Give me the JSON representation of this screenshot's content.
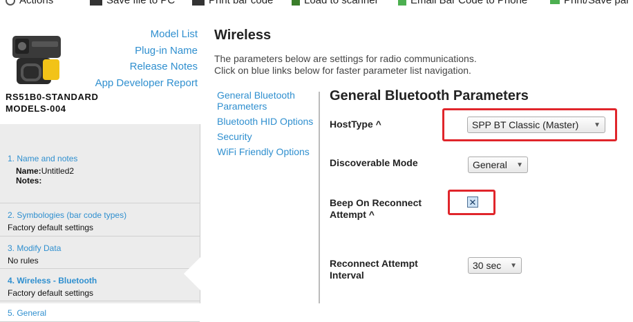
{
  "toolbar": {
    "actions": "Actions",
    "save_file": "Save file to PC",
    "print_barcode": "Print bar code",
    "load_scanner": "Load to scanner",
    "email_barcode": "Email Bar Code to Phone",
    "print_save": "Print/Save par"
  },
  "sidebar": {
    "model_links": [
      "Model List",
      "Plug-in Name",
      "Release Notes",
      "App Developer Report"
    ],
    "device_name_line1": "RS51B0-STANDARD",
    "device_name_line2": "MODELS-004",
    "steps": [
      {
        "title": "1.  Name and notes",
        "name_label": "Name:",
        "name_value": "Untitled2",
        "notes_label": "Notes:"
      },
      {
        "title": "2.  Symbologies (bar code types)",
        "sub": "Factory default settings"
      },
      {
        "title": "3.  Modify Data",
        "sub": "No rules"
      },
      {
        "title": "4.  Wireless - Bluetooth",
        "sub": "Factory default settings"
      },
      {
        "title": "5.  General"
      }
    ]
  },
  "main": {
    "title": "Wireless",
    "intro_line1": "The parameters below are settings for radio communications.",
    "intro_line2": "Click on blue links below for faster parameter list navigation.",
    "subnav": [
      "General Bluetooth Parameters",
      "Bluetooth HID Options",
      "Security",
      "WiFi Friendly Options"
    ],
    "section_title": "General Bluetooth Parameters",
    "params": {
      "hosttype_label": "HostType ^",
      "hosttype_value": "SPP BT Classic (Master)",
      "discoverable_label": "Discoverable Mode",
      "discoverable_value": "General",
      "beep_label_line1": "Beep On Reconnect",
      "beep_label_line2": "Attempt ^",
      "beep_checked": true,
      "reconnect_label_line1": "Reconnect Attempt",
      "reconnect_label_line2": "Interval",
      "reconnect_value": "30 sec"
    }
  },
  "colors": {
    "link": "#2f8fcf",
    "highlight": "#e0252b",
    "sidebar_bg": "#ececec"
  }
}
